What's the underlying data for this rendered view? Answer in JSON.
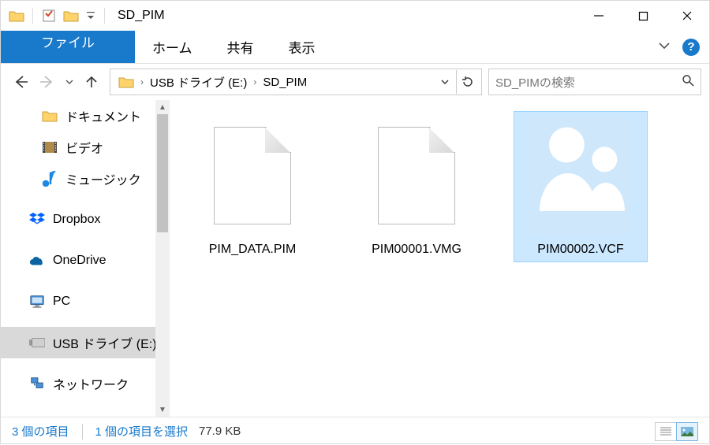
{
  "title": "SD_PIM",
  "ribbon": {
    "file": "ファイル",
    "tabs": [
      "ホーム",
      "共有",
      "表示"
    ]
  },
  "breadcrumbs": [
    "USB ドライブ (E:)",
    "SD_PIM"
  ],
  "search_placeholder": "SD_PIMの検索",
  "tree": [
    {
      "label": "ドキュメント",
      "icon": "folder"
    },
    {
      "label": "ビデオ",
      "icon": "video"
    },
    {
      "label": "ミュージック",
      "icon": "music"
    },
    {
      "label": "Dropbox",
      "icon": "dropbox"
    },
    {
      "label": "OneDrive",
      "icon": "onedrive"
    },
    {
      "label": "PC",
      "icon": "pc"
    },
    {
      "label": "USB ドライブ (E:)",
      "icon": "usb",
      "selected": true
    },
    {
      "label": "ネットワーク",
      "icon": "network"
    }
  ],
  "files": [
    {
      "name": "PIM_DATA.PIM",
      "type": "generic",
      "selected": false
    },
    {
      "name": "PIM00001.VMG",
      "type": "generic",
      "selected": false
    },
    {
      "name": "PIM00002.VCF",
      "type": "vcf",
      "selected": true
    }
  ],
  "status": {
    "count_label": "3 個の項目",
    "selection_label": "1 個の項目を選択",
    "size": "77.9 KB"
  }
}
